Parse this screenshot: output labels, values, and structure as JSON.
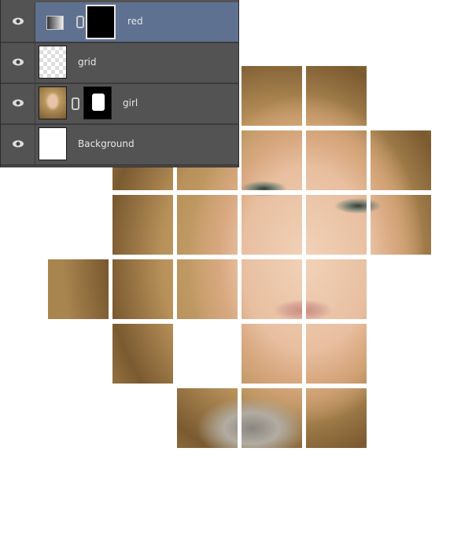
{
  "layers_panel": {
    "layers": [
      {
        "name": "red",
        "visible": true,
        "selected": true,
        "thumbnail": "gradient-map-adjustment-icon",
        "mask": "black"
      },
      {
        "name": "grid",
        "visible": true,
        "selected": false,
        "thumbnail": "transparent-checkerboard"
      },
      {
        "name": "girl",
        "visible": true,
        "selected": false,
        "thumbnail": "photo",
        "mask": "white-shape-on-black"
      },
      {
        "name": "Background",
        "visible": true,
        "selected": false,
        "thumbnail": "white"
      }
    ]
  },
  "colors": {
    "panel": "#535353",
    "selected_row": "#5f7190",
    "canvas": "#ffffff"
  }
}
